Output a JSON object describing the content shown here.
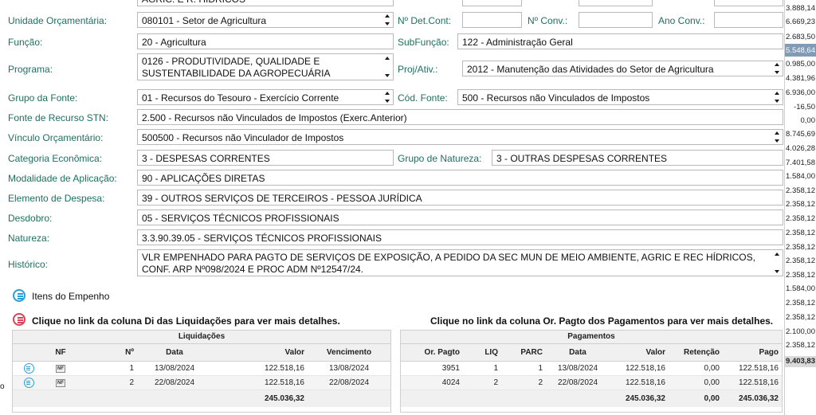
{
  "top_partial": "AGRIC. E R. HÍDRICOS",
  "fields": {
    "unidade": {
      "label": "Unidade Orçamentária:",
      "value": "080101 - Setor de Agricultura"
    },
    "det_cont": {
      "label": "Nº Det.Cont:",
      "value": ""
    },
    "conv": {
      "label": "Nº Conv.:",
      "value": ""
    },
    "ano_conv": {
      "label": "Ano Conv.:",
      "value": ""
    },
    "funcao": {
      "label": "Função:",
      "value": "20 - Agricultura"
    },
    "subfuncao": {
      "label": "SubFunção:",
      "value": "122 - Administração Geral"
    },
    "programa": {
      "label": "Programa:",
      "value": "0126 - PRODUTIVIDADE, QUALIDADE E SUSTENTABILIDADE DA AGROPECUÁRIA"
    },
    "proj_ativ": {
      "label": "Proj/Ativ.:",
      "value": "2012 - Manutenção das Atividades do Setor de Agricultura"
    },
    "grupo_fonte": {
      "label": "Grupo da Fonte:",
      "value": "01 - Recursos do Tesouro - Exercício Corrente"
    },
    "cod_fonte": {
      "label": "Cód. Fonte:",
      "value": "500 - Recursos não Vinculados de Impostos"
    },
    "fonte_stn": {
      "label": "Fonte de Recurso STN:",
      "value": "2.500 - Recursos não Vinculados de Impostos (Exerc.Anterior)"
    },
    "vinculo": {
      "label": "Vínculo Orçamentário:",
      "value": "500500 - Recursos não Vinculador de Impostos"
    },
    "categoria": {
      "label": "Categoria Econômica:",
      "value": "3 - DESPESAS CORRENTES"
    },
    "grupo_natureza": {
      "label": "Grupo de Natureza:",
      "value": "3 - OUTRAS DESPESAS CORRENTES"
    },
    "modalidade": {
      "label": "Modalidade de Aplicação:",
      "value": "90 - APLICAÇÕES DIRETAS"
    },
    "elemento": {
      "label": "Elemento de Despesa:",
      "value": "39 - OUTROS SERVIÇOS DE TERCEIROS - PESSOA JURÍDICA"
    },
    "desdobro": {
      "label": "Desdobro:",
      "value": "05 - SERVIÇOS TÉCNICOS PROFISSIONAIS"
    },
    "natureza": {
      "label": "Natureza:",
      "value": "3.3.90.39.05 - SERVIÇOS TÉCNICOS PROFISSIONAIS"
    },
    "historico": {
      "label": "Histórico:",
      "value": "VLR EMPENHADO PARA PAGTO DE SERVIÇOS DE EXPOSIÇÃO, A PEDIDO DA SEC MUN DE MEIO AMBIENTE, AGRIC E REC HÍDRICOS, CONF. ARP Nº098/2024 E PROC ADM Nº12547/24."
    }
  },
  "itens_label": "Itens do Empenho",
  "liq_note": "Clique no link da coluna Di das Liquidações para ver mais detalhes.",
  "pag_note": "Clique no link da coluna Or. Pagto dos Pagamentos para ver mais detalhes.",
  "liquidacoes": {
    "title": "Liquidações",
    "headers": [
      "",
      "NF",
      "Nº",
      "Data",
      "Valor",
      "Vencimento"
    ],
    "rows": [
      {
        "nf": "NF",
        "num": "1",
        "data": "13/08/2024",
        "valor": "122.518,16",
        "venc": "13/08/2024"
      },
      {
        "nf": "NF",
        "num": "2",
        "data": "22/08/2024",
        "valor": "122.518,16",
        "venc": "22/08/2024"
      }
    ],
    "total": "245.036,32"
  },
  "pagamentos": {
    "title": "Pagamentos",
    "headers": [
      "Or. Pagto",
      "LIQ",
      "PARC",
      "Data",
      "Valor",
      "Retenção",
      "Pago"
    ],
    "rows": [
      {
        "or": "3951",
        "liq": "1",
        "parc": "1",
        "data": "13/08/2024",
        "valor": "122.518,16",
        "ret": "0,00",
        "pago": "122.518,16"
      },
      {
        "or": "4024",
        "liq": "2",
        "parc": "2",
        "data": "22/08/2024",
        "valor": "122.518,16",
        "ret": "0,00",
        "pago": "122.518,16"
      }
    ],
    "total_valor": "245.036,32",
    "total_ret": "0,00",
    "total_pago": "245.036,32"
  },
  "right_strip": [
    "3.888,14",
    "6.669,23",
    "2.683,50",
    "5.548,64",
    "0.985,00",
    "4.381,96",
    "6.936,00",
    "-16,50",
    "0,00",
    "8.745,69",
    "4.026,28",
    "7.401,58",
    "1.584,00",
    "2.358,12",
    "2.358,12",
    "2.358,12",
    "2.358,12",
    "2.358,12",
    "2.358,12",
    "2.358,12",
    "1.584,00",
    "2.358,12",
    "2.358,12",
    "2.100,00",
    "2.358,12",
    "9.403,83"
  ],
  "bottom_left": "o",
  "colors": {
    "label": "#1f6f5f",
    "icon_blue": "#2a9fd6",
    "icon_red": "#d9435a"
  }
}
